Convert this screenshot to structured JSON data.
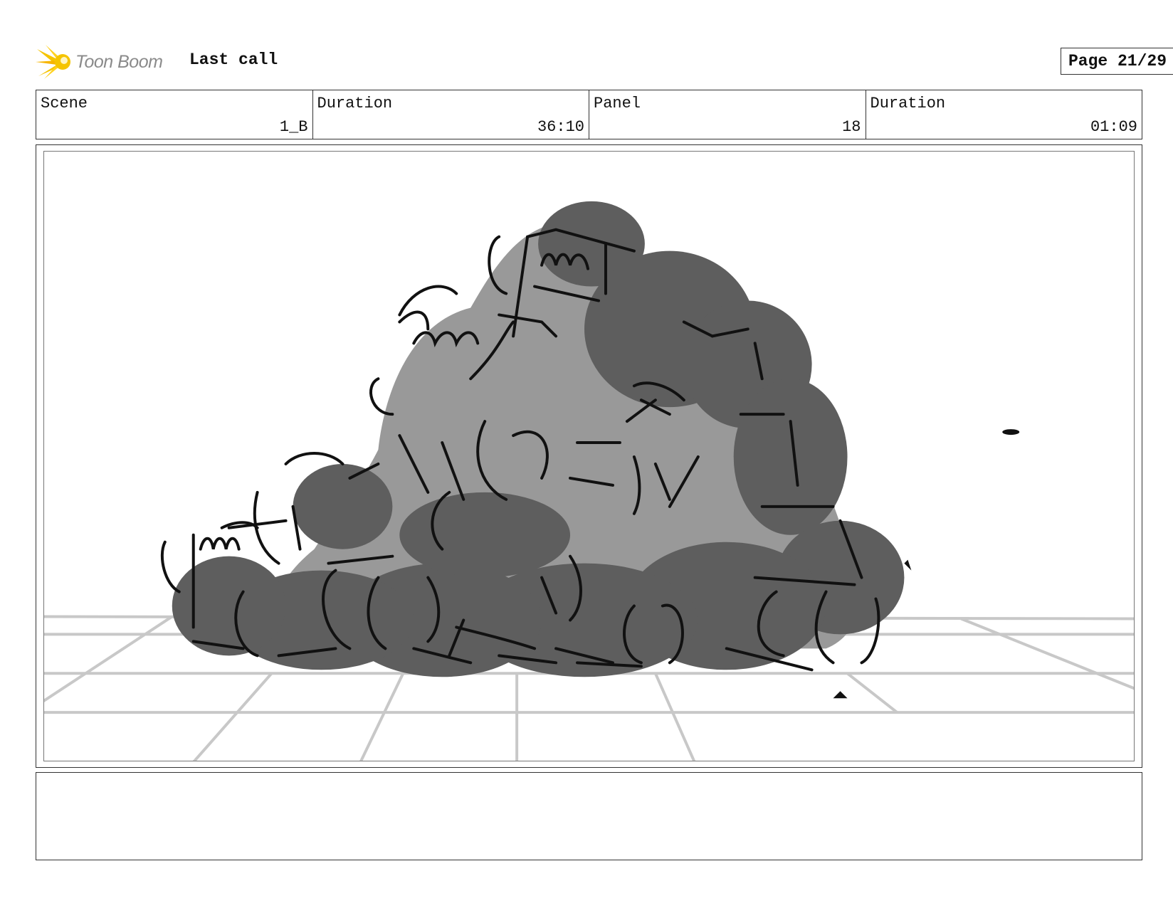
{
  "header": {
    "logo_text": "Toon Boom",
    "title": "Last call",
    "page": "Page 21/29"
  },
  "info": {
    "scene_label": "Scene",
    "scene_value": "1_B",
    "scene_duration_label": "Duration",
    "scene_duration_value": "36:10",
    "panel_label": "Panel",
    "panel_value": "18",
    "panel_duration_label": "Duration",
    "panel_duration_value": "01:09"
  },
  "notes": {
    "text": ""
  },
  "colors": {
    "logo_yellow": "#f5c400",
    "sketch_dark": "#5e5e5e",
    "sketch_mid": "#999999",
    "floor_lines": "#c8c8c8"
  }
}
